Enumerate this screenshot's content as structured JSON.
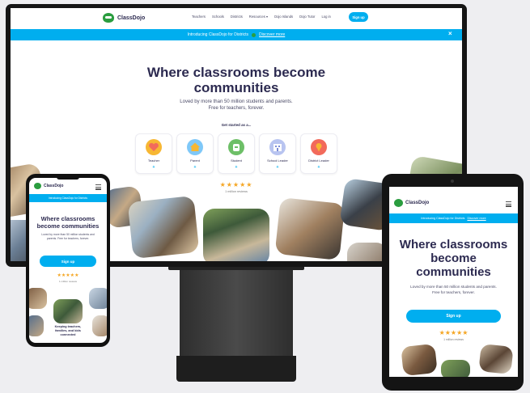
{
  "brand": {
    "name": "ClassDojo",
    "accent": "#00aeef",
    "logo_color": "#2a9d3f",
    "heading_color": "#2c2a50"
  },
  "nav": {
    "links": [
      "Teachers",
      "Schools",
      "Districts",
      "Resources",
      "Dojo Islands",
      "Dojo Tutor",
      "Log in"
    ],
    "signup_label": "Sign up"
  },
  "banner": {
    "text": "Introducing ClassDojo for Districts",
    "link": "Discover more",
    "close_icon": "close-icon"
  },
  "hero": {
    "title_line1": "Where classrooms become",
    "title_line2": "communities",
    "subtitle_line1": "Loved by more than 50 million students and parents.",
    "subtitle_line2": "Free for teachers, forever."
  },
  "get_started": "Get started as a...",
  "roles": [
    {
      "label": "Teacher",
      "icon": "heart-icon",
      "color": "#f7b733"
    },
    {
      "label": "Parent",
      "icon": "house-icon",
      "color": "#7fc8f8"
    },
    {
      "label": "Student",
      "icon": "backpack-icon",
      "color": "#6dbf67"
    },
    {
      "label": "School Leader",
      "icon": "building-icon",
      "color": "#b8c4f0"
    },
    {
      "label": "District Leader",
      "icon": "pin-icon",
      "color": "#f26a5b"
    }
  ],
  "rating": {
    "stars": "★★★★★",
    "reviews": "1 million reviews"
  },
  "phone": {
    "banner": "Introducing ClassDojo for Districts",
    "title": "Where classrooms become communities",
    "subtitle": "Loved by more than 50 million students and parents. Free for teachers, forever.",
    "signup": "Sign up",
    "stars": "★★★★★",
    "reviews": "1 million reviews",
    "caption": "Keeping teachers, families, and kids connected"
  },
  "tablet": {
    "banner": "Introducing ClassDojo for Districts",
    "banner_link": "Discover more",
    "title_line1": "Where classrooms",
    "title_line2": "become",
    "title_line3": "communities",
    "subtitle_line1": "Loved by more than 50 million students and parents.",
    "subtitle_line2": "Free for teachers, forever.",
    "signup": "Sign up",
    "stars": "★★★★★",
    "reviews": "1 million reviews"
  }
}
